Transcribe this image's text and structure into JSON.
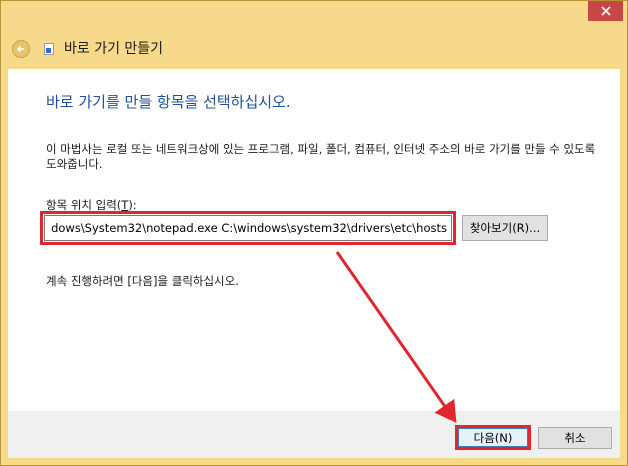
{
  "window": {
    "title": "바로 가기 만들기"
  },
  "main": {
    "heading": "바로 가기를 만들 항목을 선택하십시오.",
    "description": "이 마법사는 로컬 또는 네트워크상에 있는 프로그램, 파일, 폴더, 컴퓨터, 인터넷 주소의 바로 가기를 만들 수 있도록 도와줍니다.",
    "location_label_prefix": "항목 위치 입력(",
    "location_label_key": "T",
    "location_label_suffix": "):",
    "location_value": "dows\\System32\\notepad.exe C:\\windows\\system32\\drivers\\etc\\hosts",
    "browse_label": "찾아보기(R)...",
    "continue_text": "계속 진행하려면 [다음]을 클릭하십시오."
  },
  "footer": {
    "next_label": "다음(N)",
    "cancel_label": "취소"
  },
  "colors": {
    "frame": "#f6d98a",
    "close": "#c74747",
    "heading": "#2050a0",
    "highlight": "#e0262f"
  }
}
